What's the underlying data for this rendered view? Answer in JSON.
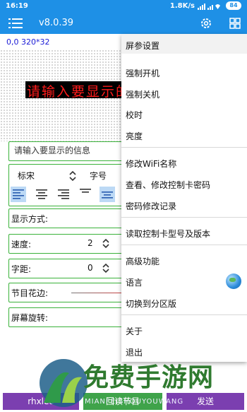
{
  "statusbar": {
    "time": "16:19",
    "network": "1.8K/s",
    "battery": "84"
  },
  "appbar": {
    "version": "v8.0.39"
  },
  "preview": {
    "coord": "0,0 320*32",
    "led_text": "请输入要显示的信息"
  },
  "editor": {
    "input_placeholder": "请输入要显示的信息",
    "font_name": "标宋",
    "font_size_label": "字号",
    "display_mode_label": "显示方式:",
    "speed_label": "速度:",
    "speed_value": "2",
    "spacing_label": "字距:",
    "spacing_value": "0",
    "border_label": "节目花边:",
    "rotation_label": "屏幕旋转:"
  },
  "bottom": {
    "btn1": "rhxleo",
    "btn2": "回读节目",
    "btn3": "发送"
  },
  "menu": {
    "header": "屏参设置",
    "items": [
      "强制开机",
      "强制关机",
      "校时",
      "亮度",
      "修改WiFi名称",
      "查看、修改控制卡密码",
      "密码修改记录",
      "读取控制卡型号及版本",
      "高级功能",
      "语言",
      "切换到分区版",
      "关于",
      "退出"
    ]
  },
  "watermark": {
    "text": "免费手游网",
    "sub": "MIANFEISHOUYOUWANG"
  },
  "colors": {
    "primary": "#1e90e6",
    "border": "#3ab23a",
    "led": "#ff1b1b"
  }
}
